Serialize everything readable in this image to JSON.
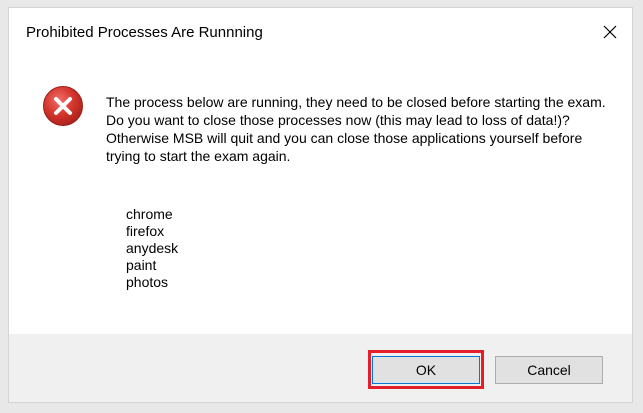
{
  "window": {
    "title": "Prohibited Processes Are Runnning",
    "close_glyph": "✕"
  },
  "icon": {
    "type": "error-icon",
    "color": "#c42b1c"
  },
  "message": {
    "text": "The process below are running, they need to be closed before starting the exam. Do you want to close those processes now (this may lead to loss of data!)? Otherwise MSB will quit and you can close those applications yourself before trying to start the exam again."
  },
  "processes": [
    "chrome",
    "firefox",
    "anydesk",
    "paint",
    "photos"
  ],
  "buttons": {
    "ok_label": "OK",
    "cancel_label": "Cancel"
  },
  "colors": {
    "highlight": "#e3202a",
    "accent": "#0078d7"
  }
}
